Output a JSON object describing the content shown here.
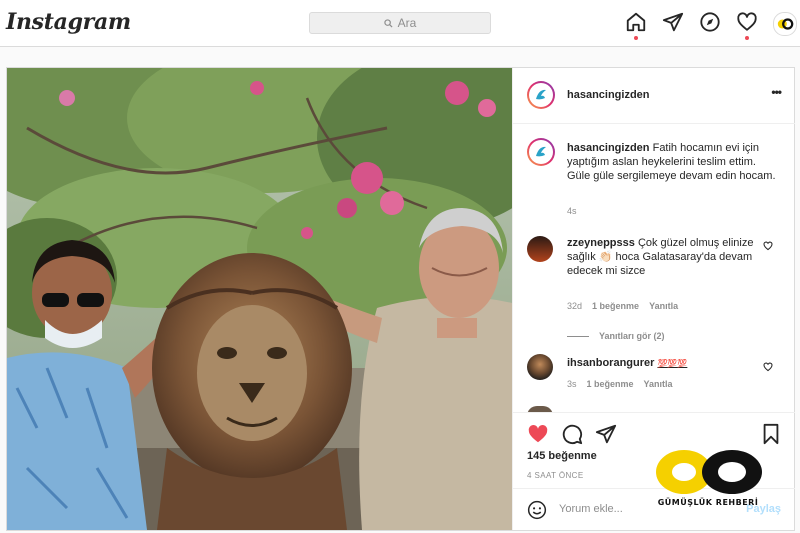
{
  "header": {
    "logo": "Instagram",
    "search_placeholder": "Ara"
  },
  "post": {
    "author": "hasancingizden",
    "caption": "Fatih hocamın evi için yaptığım aslan heykelerini teslim ettim. Güle güle sergilemeye devam edin hocam.",
    "caption_time": "4s",
    "likes": "145 beğenme",
    "posted": "4 SAAT ÖNCE",
    "more_icon": "•••"
  },
  "comments": [
    {
      "user": "zzeyneppsss",
      "text": "Çok güzel olmuş elinize sağlık 👏🏻 hoca Galatasaray'da devam edecek mi sizce",
      "time": "32d",
      "likes": "1 beğenme",
      "reply": "Yanıtla",
      "view_replies": "Yanıtları gör (2)"
    },
    {
      "user": "ihsanborangurer",
      "text": "💯💯💯",
      "time": "3s",
      "likes": "1 beğenme",
      "reply": "Yanıtla"
    }
  ],
  "add_comment": {
    "placeholder": "Yorum ekle...",
    "share": "Paylaş"
  },
  "watermark": {
    "text": "GÜMÜŞLÜK REHBERİ",
    "accent": "#f5d000"
  },
  "colors": {
    "like_red": "#ed4956",
    "muted": "#8e8e8e",
    "border": "#dbdbdb"
  }
}
